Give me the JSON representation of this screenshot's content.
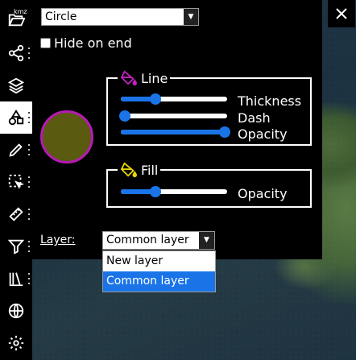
{
  "sidebar": {
    "kmz_label": "kmz",
    "items": [
      {
        "icon": "folder-open-icon",
        "has_menu": false
      },
      {
        "icon": "share-icon",
        "has_menu": true
      },
      {
        "icon": "layers-icon",
        "has_menu": false
      },
      {
        "icon": "shapes-icon",
        "has_menu": true,
        "active": true
      },
      {
        "icon": "pencil-icon",
        "has_menu": true
      },
      {
        "icon": "select-icon",
        "has_menu": true
      },
      {
        "icon": "ruler-icon",
        "has_menu": true
      },
      {
        "icon": "filter-icon",
        "has_menu": true
      },
      {
        "icon": "library-icon",
        "has_menu": true
      },
      {
        "icon": "globe-icon",
        "has_menu": false
      },
      {
        "icon": "gear-icon",
        "has_menu": false
      }
    ]
  },
  "close_icon": "close-icon",
  "panel": {
    "shape_select": {
      "value": "Circle"
    },
    "hide_on_end": {
      "label": "Hide on end",
      "checked": false
    },
    "preview": {
      "fill_color": "#5a5a10",
      "stroke_color": "#b61ab6"
    },
    "line": {
      "title": "Line",
      "icon": "paint-bucket-icon",
      "icon_color": "#c020c0",
      "sliders": [
        {
          "label": "Thickness",
          "value": 0.3
        },
        {
          "label": "Dash",
          "value": 0.0
        },
        {
          "label": "Opacity",
          "value": 1.0
        }
      ]
    },
    "fill": {
      "title": "Fill",
      "icon": "paint-bucket-icon",
      "icon_color": "#e8d800",
      "sliders": [
        {
          "label": "Opacity",
          "value": 0.3
        }
      ]
    },
    "layer": {
      "label": "Layer:",
      "value": "Common layer",
      "options": [
        "New layer",
        "Common layer"
      ],
      "selected_index": 1
    }
  },
  "colors": {
    "accent": "#1a74e8",
    "panel_bg": "#000000"
  }
}
